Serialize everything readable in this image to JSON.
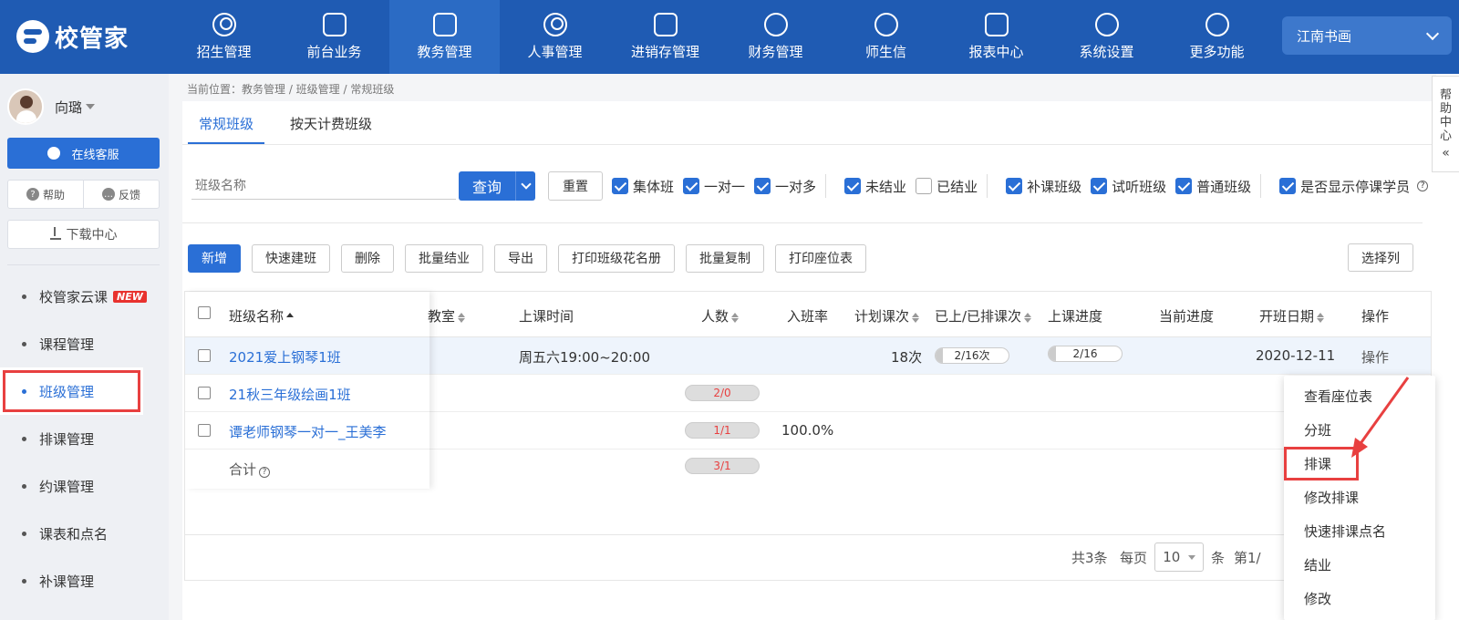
{
  "brand": {
    "name": "校管家"
  },
  "nav": {
    "items": [
      {
        "label": "招生管理",
        "icon": "user-add-icon"
      },
      {
        "label": "前台业务",
        "icon": "monitor-icon"
      },
      {
        "label": "教务管理",
        "icon": "book-icon"
      },
      {
        "label": "人事管理",
        "icon": "person-icon"
      },
      {
        "label": "进销存管理",
        "icon": "arrow-in-icon"
      },
      {
        "label": "财务管理",
        "icon": "yen-shield-icon"
      },
      {
        "label": "师生信",
        "icon": "chat-icon"
      },
      {
        "label": "报表中心",
        "icon": "chart-icon"
      },
      {
        "label": "系统设置",
        "icon": "settings-icon"
      },
      {
        "label": "更多功能",
        "icon": "more-icon"
      }
    ],
    "active_index": 2
  },
  "school": {
    "selected": "江南书画"
  },
  "sidebar": {
    "username": "向璐",
    "service_label": "在线客服",
    "help_label": "帮助",
    "feedback_label": "反馈",
    "download_label": "下载中心",
    "menu": [
      {
        "label": "校管家云课",
        "badge": "NEW"
      },
      {
        "label": "课程管理"
      },
      {
        "label": "班级管理"
      },
      {
        "label": "排课管理"
      },
      {
        "label": "约课管理"
      },
      {
        "label": "课表和点名"
      },
      {
        "label": "补课管理"
      }
    ],
    "active_index": 2
  },
  "breadcrumb": "当前位置：教务管理 / 班级管理 / 常规班级",
  "tabs": [
    "常规班级",
    "按天计费班级"
  ],
  "filters": {
    "name_placeholder": "班级名称",
    "query_label": "查询",
    "reset_label": "重置",
    "checks": [
      {
        "label": "集体班",
        "checked": true
      },
      {
        "label": "一对一",
        "checked": true
      },
      {
        "label": "一对多",
        "checked": true
      },
      {
        "label": "未结业",
        "checked": true
      },
      {
        "label": "已结业",
        "checked": false
      },
      {
        "label": "补课班级",
        "checked": true
      },
      {
        "label": "试听班级",
        "checked": true
      },
      {
        "label": "普通班级",
        "checked": true
      },
      {
        "label": "是否显示停课学员",
        "checked": true
      }
    ]
  },
  "actions": [
    "新增",
    "快速建班",
    "删除",
    "批量结业",
    "导出",
    "打印班级花名册",
    "批量复制",
    "打印座位表"
  ],
  "select_columns_label": "选择列",
  "table": {
    "headers": [
      "班级名称",
      "教室",
      "上课时间",
      "人数",
      "入班率",
      "计划课次",
      "已上/已排课次",
      "上课进度",
      "当前进度",
      "开班日期",
      "操作"
    ],
    "rows": [
      {
        "name": "2021爱上钢琴1班",
        "time": "周五六19:00~20:00",
        "count": "",
        "rate": "",
        "planned": "18次",
        "done": "2/16次",
        "progress": "2/16",
        "start": "2020-12-11",
        "op": "操作"
      },
      {
        "name": "21秋三年级绘画1班",
        "time": "",
        "count": "2/0",
        "rate": "",
        "planned": "",
        "done": "",
        "progress": "",
        "start": "",
        "op": ""
      },
      {
        "name": "谭老师钢琴一对一_王美李",
        "time": "",
        "count": "1/1",
        "rate": "100.0%",
        "planned": "",
        "done": "",
        "progress": "",
        "start": "",
        "op": ""
      }
    ],
    "total_label": "合计",
    "total_count": "3/1"
  },
  "pager": {
    "total": "共3条",
    "per_page_label": "每页",
    "per_page_value": "10",
    "unit": "条",
    "page_label": "第1/"
  },
  "dropdown": {
    "items": [
      "查看座位表",
      "分班",
      "排课",
      "修改排课",
      "快速排课点名",
      "结业",
      "修改"
    ],
    "highlight_index": 2
  },
  "help_tab": {
    "text": [
      "帮",
      "助",
      "中",
      "心"
    ],
    "collapse": "«"
  },
  "colors": {
    "primary": "#2a6fd6",
    "topbar": "#1f5bb3",
    "annotation": "#e84040"
  }
}
